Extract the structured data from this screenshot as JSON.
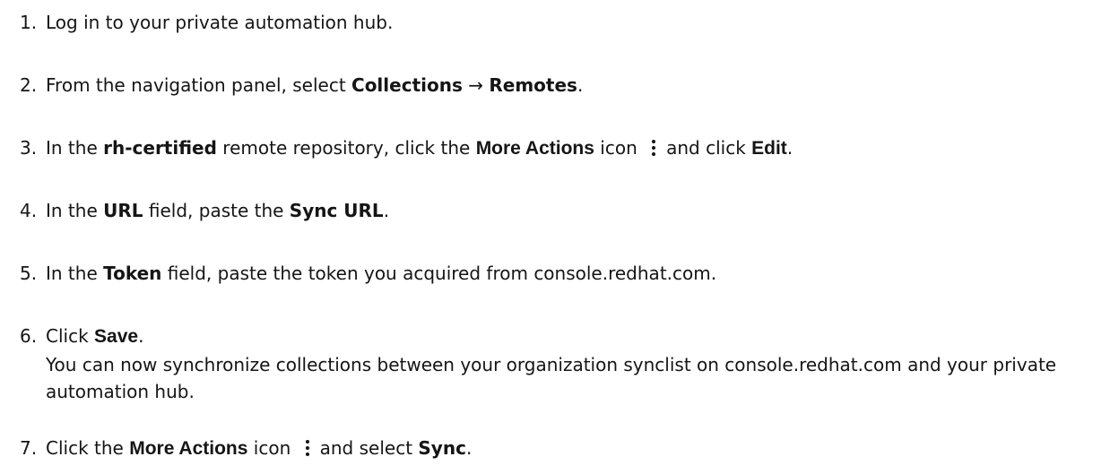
{
  "steps": [
    {
      "num": "1.",
      "parts": [
        {
          "t": "Log in to your private automation hub."
        }
      ]
    },
    {
      "num": "2.",
      "parts": [
        {
          "t": "From the navigation panel, select "
        },
        {
          "t": "Collections",
          "s": "gui"
        },
        {
          "t": " → "
        },
        {
          "t": "Remotes",
          "s": "gui"
        },
        {
          "t": "."
        }
      ]
    },
    {
      "num": "3.",
      "parts": [
        {
          "t": "In the "
        },
        {
          "t": "rh-certified",
          "s": "gui"
        },
        {
          "t": " remote repository, click the "
        },
        {
          "t": "More Actions",
          "s": "ui-bold"
        },
        {
          "t": " icon "
        },
        {
          "icon": "more-actions-icon"
        },
        {
          "t": "and click "
        },
        {
          "t": "Edit",
          "s": "ui-bold"
        },
        {
          "t": "."
        }
      ]
    },
    {
      "num": "4.",
      "parts": [
        {
          "t": "In the "
        },
        {
          "t": "URL",
          "s": "gui"
        },
        {
          "t": " field, paste the "
        },
        {
          "t": "Sync URL",
          "s": "gui"
        },
        {
          "t": "."
        }
      ]
    },
    {
      "num": "5.",
      "parts": [
        {
          "t": "In the "
        },
        {
          "t": "Token",
          "s": "gui"
        },
        {
          "t": " field, paste the token you acquired from console.redhat.com."
        }
      ]
    },
    {
      "num": "6.",
      "parts": [
        {
          "t": "Click "
        },
        {
          "t": "Save",
          "s": "ui-bold"
        },
        {
          "t": "."
        }
      ],
      "note": "You can now synchronize collections between your organization synclist on console.redhat.com and your private automation hub."
    },
    {
      "num": "7.",
      "parts": [
        {
          "t": "Click the "
        },
        {
          "t": "More Actions",
          "s": "ui-bold"
        },
        {
          "t": " icon "
        },
        {
          "icon": "more-actions-icon"
        },
        {
          "t": "and select "
        },
        {
          "t": "Sync",
          "s": "gui"
        },
        {
          "t": "."
        }
      ]
    }
  ]
}
